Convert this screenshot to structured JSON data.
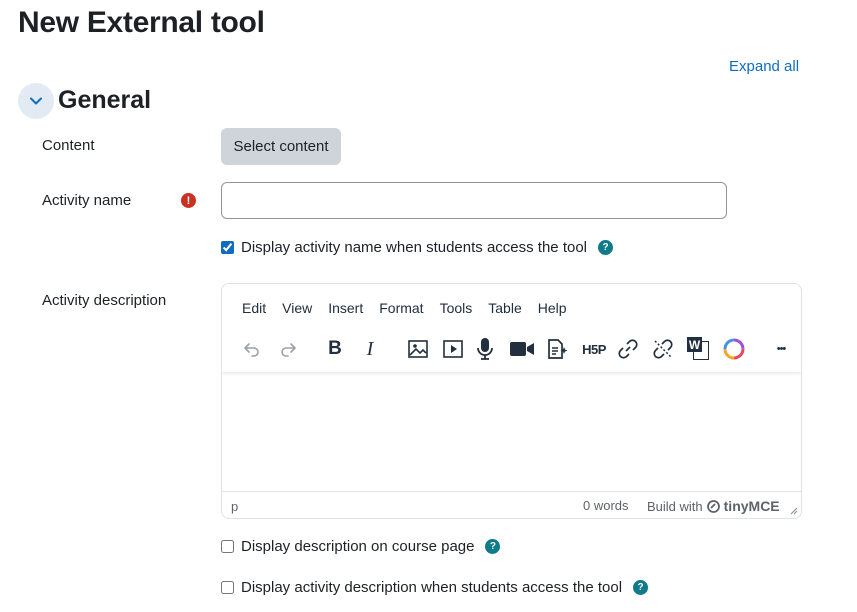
{
  "page": {
    "title": "New External tool"
  },
  "header": {
    "expand_all": "Expand all"
  },
  "section": {
    "title": "General"
  },
  "fields": {
    "content": {
      "label": "Content",
      "button": "Select content"
    },
    "activity_name": {
      "label": "Activity name",
      "required_icon": "!",
      "value": ""
    },
    "display_name_checkbox": {
      "label": "Display activity name when students access the tool",
      "checked": true
    },
    "activity_description": {
      "label": "Activity description"
    },
    "display_desc_course": {
      "label": "Display description on course page",
      "checked": false
    },
    "display_desc_students": {
      "label": "Display activity description when students access the tool",
      "checked": false
    }
  },
  "help_icon": "?",
  "editor": {
    "menu": [
      "Edit",
      "View",
      "Insert",
      "Format",
      "Tools",
      "Table",
      "Help"
    ],
    "toolbar": [
      "undo-icon",
      "redo-icon",
      "bold-icon",
      "italic-icon",
      "image-icon",
      "media-icon",
      "record-audio-icon",
      "record-video-icon",
      "manage-files-icon",
      "h5p-icon",
      "link-icon",
      "unlink-icon",
      "word-import-icon",
      "generico-icon",
      "more-icon"
    ],
    "bold_label": "B",
    "italic_label": "I",
    "h5p_label": "H5P",
    "word_label": "W",
    "more_label": "•••",
    "status": {
      "path": "p",
      "words": "0 words",
      "build_with": "Build with",
      "brand": "tinyMCE"
    }
  },
  "colors": {
    "link": "#0f6cbf",
    "required": "#ca3120",
    "help": "#0f7a8a",
    "button": "#ced4da"
  }
}
